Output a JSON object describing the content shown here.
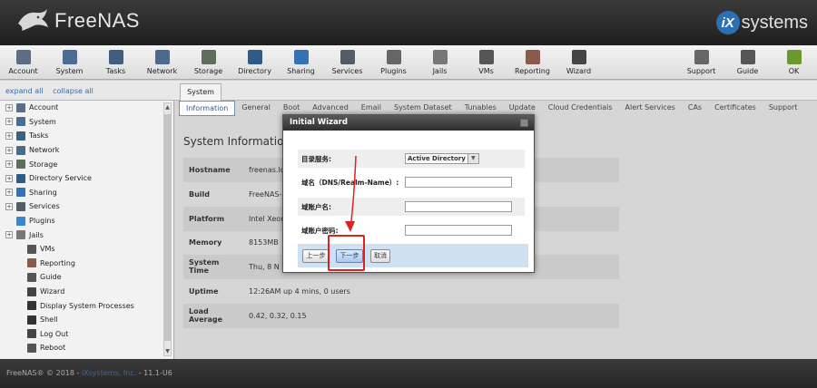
{
  "header": {
    "logo_text": "FreeNAS",
    "vendor_logo_mark": "iX",
    "vendor_logo_text": "systems"
  },
  "toolbar": {
    "left": [
      {
        "label": "Account",
        "icon": "account-icon",
        "color": "#5b6e86"
      },
      {
        "label": "System",
        "icon": "system-icon",
        "color": "#4b6d91"
      },
      {
        "label": "Tasks",
        "icon": "tasks-icon",
        "color": "#3f5f80"
      },
      {
        "label": "Network",
        "icon": "network-icon",
        "color": "#4c6a8c"
      },
      {
        "label": "Storage",
        "icon": "storage-icon",
        "color": "#5c6f59"
      },
      {
        "label": "Directory",
        "icon": "directory-icon",
        "color": "#2f5b88"
      },
      {
        "label": "Sharing",
        "icon": "sharing-icon",
        "color": "#3572b4"
      },
      {
        "label": "Services",
        "icon": "services-icon",
        "color": "#555c66"
      },
      {
        "label": "Plugins",
        "icon": "plugins-icon",
        "color": "#666666"
      },
      {
        "label": "Jails",
        "icon": "jails-icon",
        "color": "#777777"
      },
      {
        "label": "VMs",
        "icon": "vms-icon",
        "color": "#555555"
      },
      {
        "label": "Reporting",
        "icon": "reporting-icon",
        "color": "#8a5a4a"
      },
      {
        "label": "Wizard",
        "icon": "wizard-icon",
        "color": "#444444"
      }
    ],
    "right": [
      {
        "label": "Support",
        "icon": "support-icon",
        "color": "#666666"
      },
      {
        "label": "Guide",
        "icon": "guide-icon",
        "color": "#555555"
      },
      {
        "label": "OK",
        "icon": "ok-icon",
        "color": "#6a9a2a"
      }
    ]
  },
  "subbar": {
    "expand_all": "expand all",
    "collapse_all": "collapse all",
    "system_tab": "System"
  },
  "sidebar": {
    "items": [
      {
        "label": "Account",
        "icon": "account-icon",
        "expandable": true,
        "child": false,
        "color": "#5b6e86"
      },
      {
        "label": "System",
        "icon": "system-icon",
        "expandable": true,
        "child": false,
        "color": "#4b6d91"
      },
      {
        "label": "Tasks",
        "icon": "tasks-icon",
        "expandable": true,
        "child": false,
        "color": "#3f5f80"
      },
      {
        "label": "Network",
        "icon": "network-icon",
        "expandable": true,
        "child": false,
        "color": "#4c6a8c"
      },
      {
        "label": "Storage",
        "icon": "storage-icon",
        "expandable": true,
        "child": false,
        "color": "#5c6f59"
      },
      {
        "label": "Directory Service",
        "icon": "directory-icon",
        "expandable": true,
        "child": false,
        "color": "#2f5b88"
      },
      {
        "label": "Sharing",
        "icon": "sharing-icon",
        "expandable": true,
        "child": false,
        "color": "#3572b4"
      },
      {
        "label": "Services",
        "icon": "services-icon",
        "expandable": true,
        "child": false,
        "color": "#555c66"
      },
      {
        "label": "Plugins",
        "icon": "plugins-icon",
        "expandable": false,
        "child": false,
        "color": "#3a88c8"
      },
      {
        "label": "Jails",
        "icon": "jails-icon",
        "expandable": true,
        "child": false,
        "color": "#777777"
      },
      {
        "label": "VMs",
        "icon": "vms-icon",
        "expandable": false,
        "child": true,
        "color": "#555555"
      },
      {
        "label": "Reporting",
        "icon": "reporting-icon",
        "expandable": false,
        "child": true,
        "color": "#8a5a4a"
      },
      {
        "label": "Guide",
        "icon": "guide-icon",
        "expandable": false,
        "child": true,
        "color": "#555555"
      },
      {
        "label": "Wizard",
        "icon": "wizard-icon",
        "expandable": false,
        "child": true,
        "color": "#444444"
      },
      {
        "label": "Display System Processes",
        "icon": "processes-icon",
        "expandable": false,
        "child": true,
        "color": "#333333"
      },
      {
        "label": "Shell",
        "icon": "shell-icon",
        "expandable": false,
        "child": true,
        "color": "#333333"
      },
      {
        "label": "Log Out",
        "icon": "logout-icon",
        "expandable": false,
        "child": true,
        "color": "#444444"
      },
      {
        "label": "Reboot",
        "icon": "reboot-icon",
        "expandable": false,
        "child": true,
        "color": "#555555"
      }
    ]
  },
  "content": {
    "tabs": [
      "Information",
      "General",
      "Boot",
      "Advanced",
      "Email",
      "System Dataset",
      "Tunables",
      "Update",
      "Cloud Credentials",
      "Alert Services",
      "CAs",
      "Certificates",
      "Support"
    ],
    "active_tab": "Information",
    "title": "System Information",
    "rows": [
      {
        "key": "Hostname",
        "value": "freenas.lo"
      },
      {
        "key": "Build",
        "value": "FreeNAS-"
      },
      {
        "key": "Platform",
        "value": "Intel Xeon"
      },
      {
        "key": "Memory",
        "value": "8153MB"
      },
      {
        "key": "System Time",
        "value": "Thu, 8 N"
      },
      {
        "key": "Uptime",
        "value": "12:26AM up 4 mins, 0 users"
      },
      {
        "key": "Load Average",
        "value": "0.42, 0.32, 0.15"
      }
    ]
  },
  "dialog": {
    "title": "Initial Wizard",
    "fields": [
      {
        "label": "目录服务:",
        "type": "select",
        "value": "Active Directory"
      },
      {
        "label": "域名（DNS/Realm-Name）:",
        "type": "text",
        "value": ""
      },
      {
        "label": "域账户名:",
        "type": "text",
        "value": ""
      },
      {
        "label": "域账户密码:",
        "type": "password",
        "value": ""
      }
    ],
    "buttons": {
      "prev": "上一步",
      "next": "下一步",
      "cancel": "取消"
    }
  },
  "footer": {
    "copyright": "FreeNAS® © 2018 - ",
    "company": "iXsystems, Inc.",
    "version": " - 11.1-U6"
  },
  "colors": {
    "highlight": "#e02020",
    "link": "#3a6aa8"
  }
}
